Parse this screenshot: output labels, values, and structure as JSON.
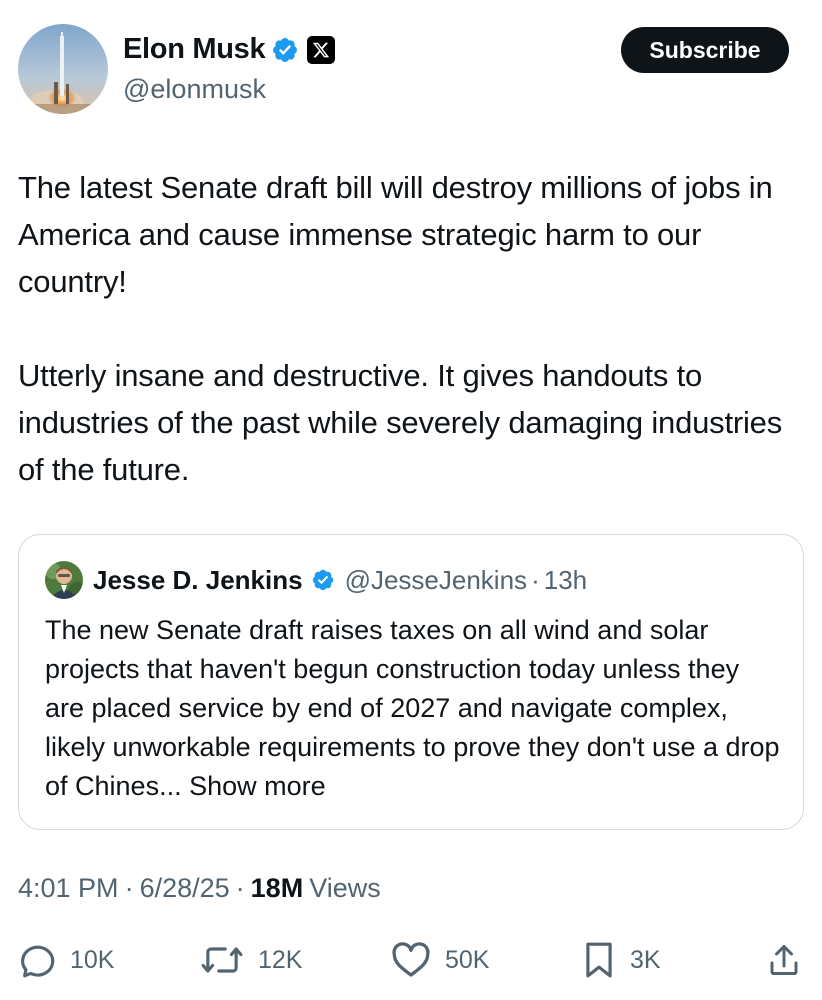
{
  "author": {
    "name": "Elon Musk",
    "handle": "@elonmusk",
    "verified_color": "#1d9bf0"
  },
  "header": {
    "subscribe_label": "Subscribe"
  },
  "tweet": {
    "paragraphs": [
      "The latest Senate draft bill will destroy millions of jobs in America and cause immense strategic harm to our country!",
      "Utterly insane and destructive. It gives handouts to industries of the past while severely damaging industries of the future."
    ]
  },
  "quote": {
    "name": "Jesse D. Jenkins",
    "handle": "@JesseJenkins",
    "separator": "·",
    "time": "13h",
    "text": "The new Senate draft raises taxes on all wind and solar projects that haven't begun construction today unless they are placed service by end of 2027 and navigate complex, likely unworkable requirements to prove they don't use a drop of Chines...",
    "show_more": "Show more"
  },
  "meta": {
    "time": "4:01 PM",
    "sep1": "·",
    "date": "6/28/25",
    "sep2": "·",
    "views_count": "18M",
    "views_label": "Views"
  },
  "actions": {
    "replies": "10K",
    "reposts": "12K",
    "likes": "50K",
    "bookmarks": "3K"
  },
  "icons": {
    "verified": "verified-badge-icon",
    "x_logo": "x-logo-icon",
    "reply": "reply-icon",
    "repost": "repost-icon",
    "like": "heart-icon",
    "bookmark": "bookmark-icon",
    "share": "share-icon"
  }
}
